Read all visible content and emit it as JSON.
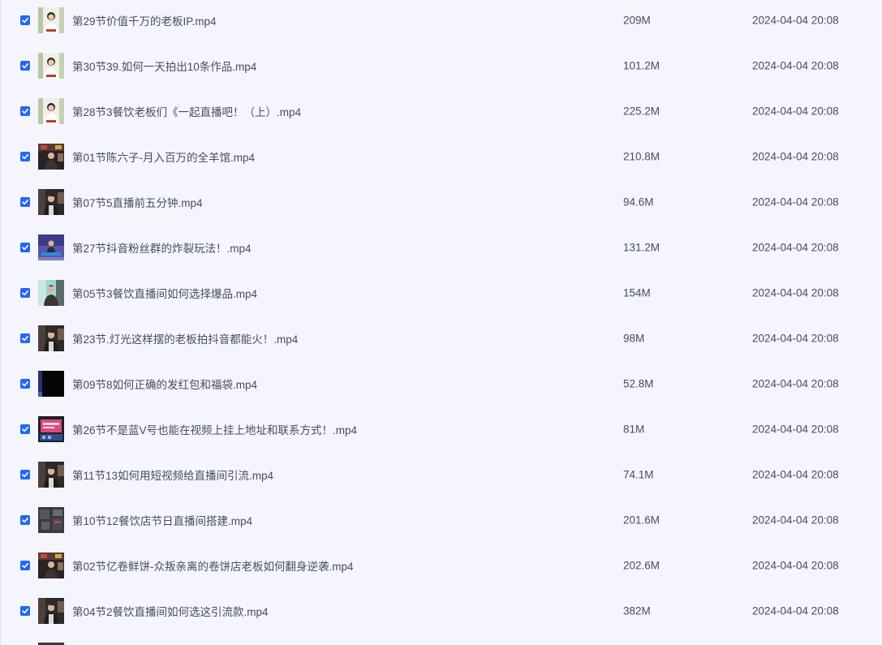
{
  "files": [
    {
      "name": "第29节价值千万的老板IP.mp4",
      "size": "209M",
      "modified": "2024-04-04 20:08",
      "checked": true,
      "thumb": "white-person"
    },
    {
      "name": "第30节39.如何一天拍出10条作品.mp4",
      "size": "101.2M",
      "modified": "2024-04-04 20:08",
      "checked": true,
      "thumb": "white-person"
    },
    {
      "name": "第28节3餐饮老板们《一起直播吧！（上）.mp4",
      "size": "225.2M",
      "modified": "2024-04-04 20:08",
      "checked": true,
      "thumb": "white-person"
    },
    {
      "name": "第01节陈六子-月入百万的全羊馆.mp4",
      "size": "210.8M",
      "modified": "2024-04-04 20:08",
      "checked": true,
      "thumb": "dark-shop"
    },
    {
      "name": "第07节5直播前五分钟.mp4",
      "size": "94.6M",
      "modified": "2024-04-04 20:08",
      "checked": true,
      "thumb": "dark-person"
    },
    {
      "name": "第27节抖音粉丝群的炸裂玩法！.mp4",
      "size": "131.2M",
      "modified": "2024-04-04 20:08",
      "checked": true,
      "thumb": "blue-stage"
    },
    {
      "name": "第05节3餐饮直播间如何选择爆品.mp4",
      "size": "154M",
      "modified": "2024-04-04 20:08",
      "checked": true,
      "thumb": "teal-person"
    },
    {
      "name": "第23节.灯光这样摆的老板拍抖音都能火！.mp4",
      "size": "98M",
      "modified": "2024-04-04 20:08",
      "checked": true,
      "thumb": "dark-person"
    },
    {
      "name": "第09节8如何正确的发红包和福袋.mp4",
      "size": "52.8M",
      "modified": "2024-04-04 20:08",
      "checked": true,
      "thumb": "black"
    },
    {
      "name": "第26节不是蓝V号也能在视频上挂上地址和联系方式！.mp4",
      "size": "81M",
      "modified": "2024-04-04 20:08",
      "checked": true,
      "thumb": "phone-screen"
    },
    {
      "name": "第11节13如何用短视频给直播间引流.mp4",
      "size": "74.1M",
      "modified": "2024-04-04 20:08",
      "checked": true,
      "thumb": "dark-person"
    },
    {
      "name": "第10节12餐饮店节日直播间搭建.mp4",
      "size": "201.6M",
      "modified": "2024-04-04 20:08",
      "checked": true,
      "thumb": "grey-room"
    },
    {
      "name": "第02节亿卷鲜饼-众叛亲离的卷饼店老板如何翻身逆袭.mp4",
      "size": "202.6M",
      "modified": "2024-04-04 20:08",
      "checked": true,
      "thumb": "dark-shop"
    },
    {
      "name": "第04节2餐饮直播间如何选这引流款.mp4",
      "size": "382M",
      "modified": "2024-04-04 20:08",
      "checked": true,
      "thumb": "dark-person"
    }
  ],
  "colors": {
    "background": "#f5f6fd",
    "checkbox": "#2468f2",
    "text": "#454d5a"
  }
}
